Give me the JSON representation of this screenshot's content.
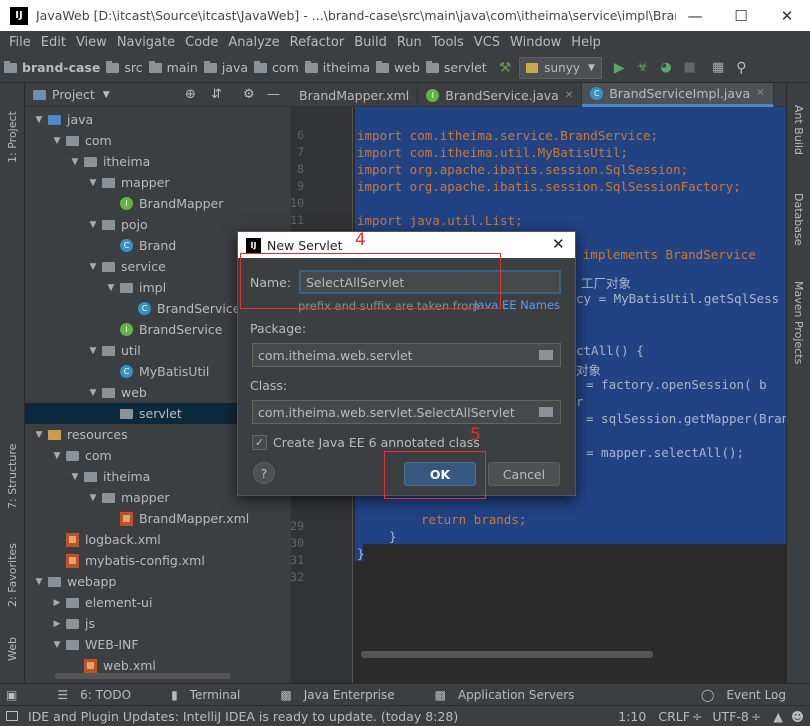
{
  "window": {
    "title": "JavaWeb [D:\\itcast\\Source\\itcast\\JavaWeb] - ...\\brand-case\\src\\main\\java\\com\\itheima\\service\\impl\\BrandS...",
    "logo": "IJ"
  },
  "menu": [
    "File",
    "Edit",
    "View",
    "Navigate",
    "Code",
    "Analyze",
    "Refactor",
    "Build",
    "Run",
    "Tools",
    "VCS",
    "Window",
    "Help"
  ],
  "breadcrumbs": [
    "brand-case",
    "src",
    "main",
    "java",
    "com",
    "itheima",
    "web",
    "servlet"
  ],
  "run_config": "sunyy",
  "project_panel": {
    "title": "Project"
  },
  "tree": [
    {
      "label": "java",
      "depth": 0,
      "icon": "java-folder",
      "arrow": "down"
    },
    {
      "label": "com",
      "depth": 1,
      "icon": "package",
      "arrow": "down"
    },
    {
      "label": "itheima",
      "depth": 2,
      "icon": "package",
      "arrow": "down"
    },
    {
      "label": "mapper",
      "depth": 3,
      "icon": "package",
      "arrow": "down"
    },
    {
      "label": "BrandMapper",
      "depth": 4,
      "icon": "interface",
      "arrow": ""
    },
    {
      "label": "pojo",
      "depth": 3,
      "icon": "package",
      "arrow": "down"
    },
    {
      "label": "Brand",
      "depth": 4,
      "icon": "class",
      "arrow": ""
    },
    {
      "label": "service",
      "depth": 3,
      "icon": "package",
      "arrow": "down"
    },
    {
      "label": "impl",
      "depth": 4,
      "icon": "package",
      "arrow": "down"
    },
    {
      "label": "BrandService",
      "depth": 5,
      "icon": "class",
      "arrow": ""
    },
    {
      "label": "BrandService",
      "depth": 4,
      "icon": "interface",
      "arrow": ""
    },
    {
      "label": "util",
      "depth": 3,
      "icon": "package",
      "arrow": "down"
    },
    {
      "label": "MyBatisUtil",
      "depth": 4,
      "icon": "class",
      "arrow": ""
    },
    {
      "label": "web",
      "depth": 3,
      "icon": "package",
      "arrow": "down"
    },
    {
      "label": "servlet",
      "depth": 4,
      "icon": "package",
      "arrow": "",
      "selected": true
    },
    {
      "label": "resources",
      "depth": 0,
      "icon": "resources-folder",
      "arrow": "down"
    },
    {
      "label": "com",
      "depth": 1,
      "icon": "package",
      "arrow": "down"
    },
    {
      "label": "itheima",
      "depth": 2,
      "icon": "package",
      "arrow": "down"
    },
    {
      "label": "mapper",
      "depth": 3,
      "icon": "package",
      "arrow": "down"
    },
    {
      "label": "BrandMapper.xml",
      "depth": 4,
      "icon": "xml",
      "arrow": ""
    },
    {
      "label": "logback.xml",
      "depth": 1,
      "icon": "xml",
      "arrow": ""
    },
    {
      "label": "mybatis-config.xml",
      "depth": 1,
      "icon": "xml",
      "arrow": ""
    },
    {
      "label": "webapp",
      "depth": 0,
      "icon": "package",
      "arrow": "down"
    },
    {
      "label": "element-ui",
      "depth": 1,
      "icon": "package",
      "arrow": "right"
    },
    {
      "label": "js",
      "depth": 1,
      "icon": "package",
      "arrow": "right"
    },
    {
      "label": "WEB-INF",
      "depth": 1,
      "icon": "package",
      "arrow": "down"
    },
    {
      "label": "web.xml",
      "depth": 2,
      "icon": "xml",
      "arrow": ""
    }
  ],
  "tabs": [
    "BrandMapper.xml",
    "BrandService.java",
    "BrandServiceImpl.java"
  ],
  "tab_overflow": "⋮2",
  "line_numbers": [
    "6",
    "7",
    "8",
    "9",
    "10",
    "11",
    "12",
    "",
    "",
    "",
    "",
    "",
    "",
    "",
    "",
    "",
    "",
    "",
    "",
    "",
    "",
    "",
    "",
    "29",
    "30",
    "31",
    "32"
  ],
  "code_lines": [
    {
      "line": "6",
      "text": "import com.itheima.service.BrandService;"
    },
    {
      "line": "7",
      "text": "import com.itheima.util.MyBatisUtil;"
    },
    {
      "line": "8",
      "text": "import org.apache.ibatis.session.SqlSession;"
    },
    {
      "line": "9",
      "text": "import org.apache.ibatis.session.SqlSessionFactory;"
    },
    {
      "line": "11",
      "text": "import java.util.List;"
    },
    {
      "line": "13",
      "text": "public class BrandServiceImpl implements BrandService"
    },
    {
      "line": "15",
      "text": "工厂对象"
    },
    {
      "line": "16",
      "text": "cy = MyBatisUtil.getSqlSess"
    },
    {
      "line": "19",
      "text": "ctAll() {"
    },
    {
      "line": "20",
      "text": "对象"
    },
    {
      "line": "21",
      "text": "= factory.openSession( b"
    },
    {
      "line": "22",
      "text": "r"
    },
    {
      "line": "23",
      "text": "= sqlSession.getMapper(Bran"
    },
    {
      "line": "25",
      "text": "= mapper.selectAll();"
    },
    {
      "line": "29",
      "text": "return brands;"
    },
    {
      "line": "30",
      "text": "}"
    },
    {
      "line": "31",
      "text": "}"
    }
  ],
  "left_strip": [
    "1: Project",
    "7: Structure",
    "2: Favorites",
    "Web"
  ],
  "right_strip": [
    "Ant Build",
    "Database",
    "Maven Projects"
  ],
  "bottom_tools": [
    "6: TODO",
    "Terminal",
    "Java Enterprise",
    "Application Servers",
    "Event Log"
  ],
  "status": {
    "message": "IDE and Plugin Updates: IntelliJ IDEA is ready to update. (today 8:28)",
    "position": "1:10",
    "line_sep": "CRLF",
    "line_sep_arrow": "÷",
    "encoding": "UTF-8",
    "encoding_arrow": "÷"
  },
  "dialog": {
    "title": "New Servlet",
    "name_label": "Name:",
    "name_value": "SelectAllServlet",
    "hint": "prefix and suffix are taken from",
    "hint_link": "Java EE Names",
    "package_label": "Package:",
    "package_value": "com.itheima.web.servlet",
    "class_label": "Class:",
    "class_value": "com.itheima.web.servlet.SelectAllServlet",
    "checkbox_label": "Create Java EE 6 annotated class",
    "ok": "OK",
    "cancel": "Cancel",
    "help": "?"
  },
  "annotations": {
    "a4": "4",
    "a5": "5",
    "color": "#e03030"
  },
  "colors": {
    "accent": "#4a88c7",
    "selection": "#214283",
    "tree_selected": "#0d293e"
  }
}
